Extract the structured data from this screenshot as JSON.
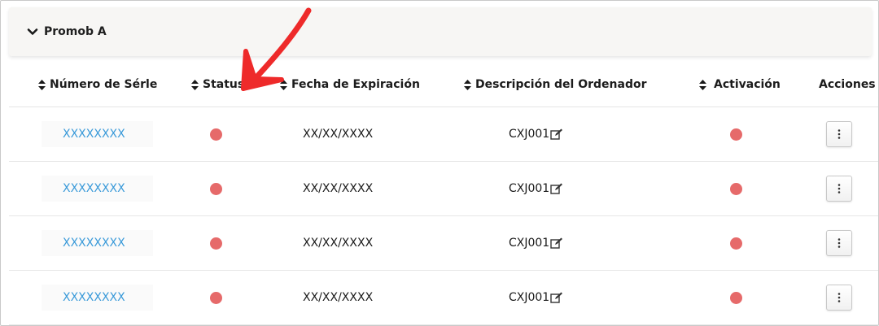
{
  "panel": {
    "title": "Promob A",
    "expanded_icon": "chevron-down-icon"
  },
  "table": {
    "columns": [
      {
        "key": "serial",
        "label": "Número de Sérle",
        "sortable": true
      },
      {
        "key": "status",
        "label": "Status",
        "sortable": true
      },
      {
        "key": "expiry",
        "label": "Fecha de Expiración",
        "sortable": true
      },
      {
        "key": "description",
        "label": "Descripción del Ordenador",
        "sortable": true
      },
      {
        "key": "activation",
        "label": "Activación",
        "sortable": true
      },
      {
        "key": "actions",
        "label": "Acciones",
        "sortable": false
      }
    ],
    "rows": [
      {
        "serial": "XXXXXXXX",
        "status": "red",
        "expiry": "XX/XX/XXXX",
        "description": "CXJ001",
        "activation": "red"
      },
      {
        "serial": "XXXXXXXX",
        "status": "red",
        "expiry": "XX/XX/XXXX",
        "description": "CXJ001",
        "activation": "red"
      },
      {
        "serial": "XXXXXXXX",
        "status": "red",
        "expiry": "XX/XX/XXXX",
        "description": "CXJ001",
        "activation": "red"
      },
      {
        "serial": "XXXXXXXX",
        "status": "red",
        "expiry": "XX/XX/XXXX",
        "description": "CXJ001",
        "activation": "red"
      }
    ]
  },
  "colors": {
    "link": "#3a9ad9",
    "status_red": "#e66a6a",
    "annotation_arrow": "#ee2a2a",
    "header_bg": "#f7f6f4"
  },
  "icons": {
    "sort": "sort-icon",
    "edit": "edit-icon",
    "actions": "vertical-dots-icon",
    "annotation": "red-arrow-icon"
  }
}
